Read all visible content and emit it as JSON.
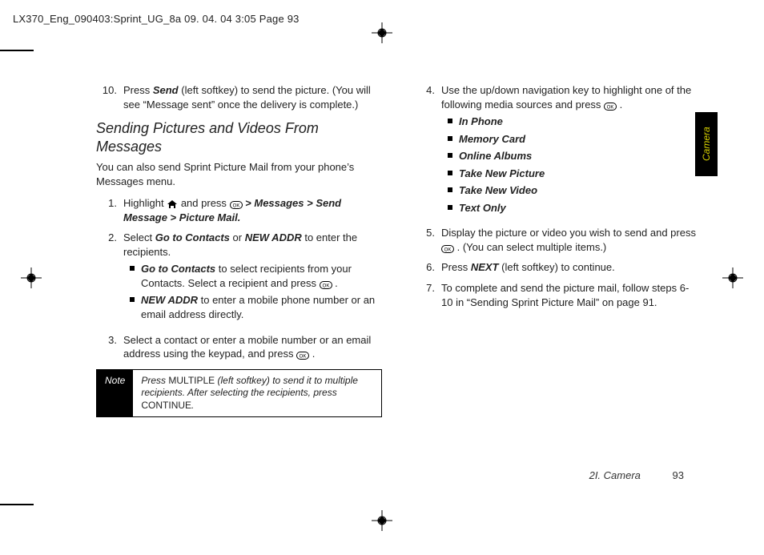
{
  "header": "LX370_Eng_090403:Sprint_UG_8a  09. 04. 04    3:05  Page 93",
  "sideTab": "Camera",
  "footer": {
    "section": "2I. Camera",
    "page": "93"
  },
  "left": {
    "step10_num": "10.",
    "step10": "Press ",
    "step10_bold": "Send",
    "step10_after": " (left softkey) to send the picture. (You will see “Message sent” once the delivery is complete.)",
    "heading": "Sending Pictures and Videos From Messages",
    "intro": "You can also send Sprint Picture Mail from your phone’s Messages menu.",
    "s1_num": "1.",
    "s1_a": "Highlight ",
    "s1_b": " and press ",
    "s1_path": " > Messages > Send Message > Picture Mail.",
    "s2_num": "2.",
    "s2_a": "Select ",
    "s2_b1": "Go to Contacts",
    "s2_mid": " or ",
    "s2_b2": "NEW ADDR",
    "s2_c": " to enter the recipients.",
    "s2_sub1_b": "Go to Contacts",
    "s2_sub1_rest": "  to select recipients from your Contacts. Select a recipient and press ",
    "s2_sub1_end": " .",
    "s2_sub2_b": "NEW ADDR",
    "s2_sub2_rest": "  to enter a mobile phone number or an email address directly.",
    "s3_num": "3.",
    "s3": "Select a contact or enter a mobile number or an email address using the keypad, and press ",
    "s3_end": " .",
    "note_label": "Note",
    "note_a": "Press  ",
    "note_b": "MULTIPLE",
    "note_c": " (left softkey) to send it to multiple recipients. After selecting the recipients, press ",
    "note_d": "CONTINUE",
    "note_e": "."
  },
  "right": {
    "s4_num": "4.",
    "s4_a": "Use the up/down navigation key to highlight one of the following media sources and press ",
    "s4_end": " .",
    "bullets": [
      "In Phone",
      "Memory Card",
      "Online Albums",
      "Take New Picture",
      "Take New Video",
      "Text Only"
    ],
    "s5_num": "5.",
    "s5_a": "Display the picture or video you wish to send and press ",
    "s5_b": " . (You can select multiple items.)",
    "s6_num": "6.",
    "s6_a": "Press ",
    "s6_b": "NEXT",
    "s6_c": " (left softkey) to continue.",
    "s7_num": "7.",
    "s7": "To complete and send the picture mail, follow steps 6-10 in “Sending Sprint Picture Mail” on page 91."
  }
}
